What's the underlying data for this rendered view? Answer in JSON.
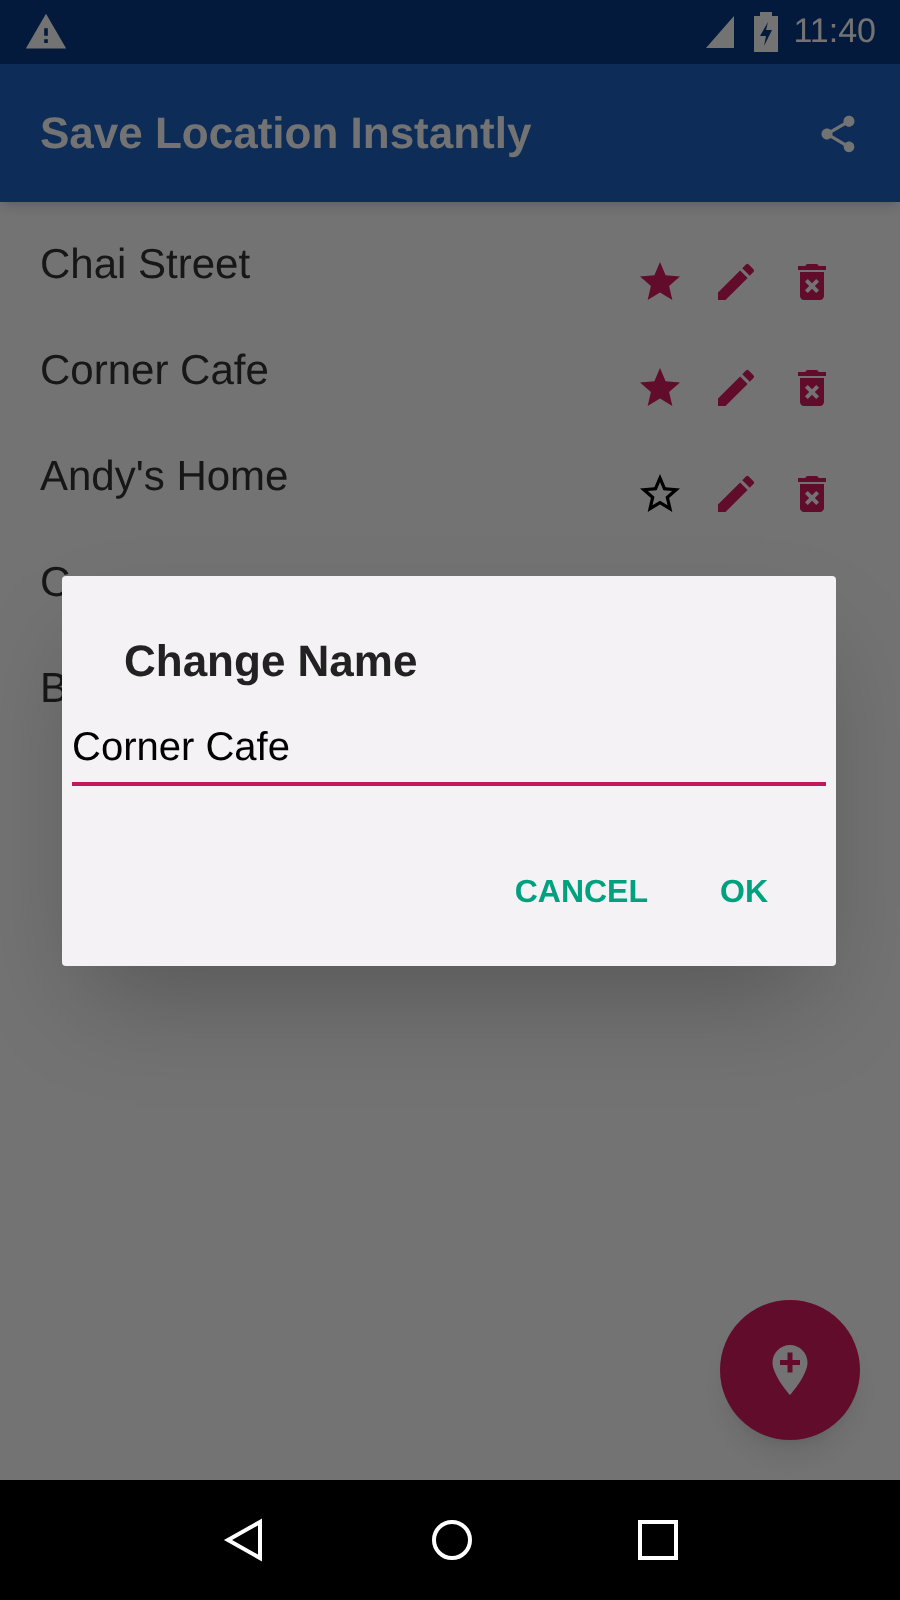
{
  "status_bar": {
    "time": "11:40"
  },
  "app_bar": {
    "title": "Save Location Instantly"
  },
  "locations": [
    {
      "name": "Chai Street",
      "starred": true
    },
    {
      "name": "Corner Cafe",
      "starred": true
    },
    {
      "name": "Andy's Home",
      "starred": false
    },
    {
      "name": "C"
    },
    {
      "name": "B"
    }
  ],
  "dialog": {
    "title": "Change Name",
    "value": "Corner Cafe",
    "buttons": [
      "CANCEL",
      "OK"
    ]
  }
}
